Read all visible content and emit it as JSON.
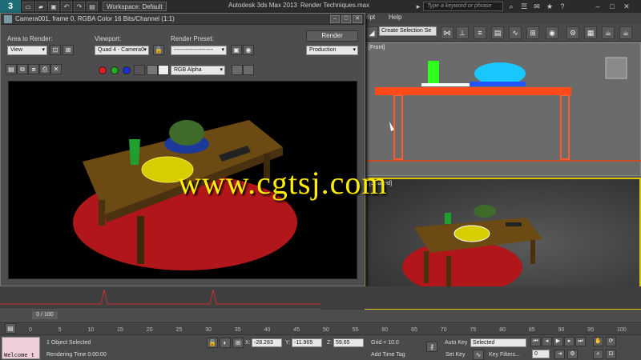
{
  "titlebar": {
    "logo": "3",
    "workspace": "Workspace: Default",
    "app_title": "Autodesk 3ds Max  2013",
    "file_title": "Render Techniques.max",
    "search_placeholder": "Type a keyword or phrase"
  },
  "menu": {
    "items": [
      "ript",
      "Help"
    ]
  },
  "toolbar": {
    "selection_set": "Create Selection Se"
  },
  "render_window": {
    "title": "Camera001, frame 0, RGBA Color 16 Bits/Channel (1:1)",
    "area_label": "Area to Render:",
    "area_value": "View",
    "viewport_label": "Viewport:",
    "viewport_value": "Quad 4 - Camera0",
    "preset_label": "Render Preset:",
    "preset_value": "---------------------",
    "render_button": "Render",
    "production_value": "Production",
    "channel_value": "RGB Alpha"
  },
  "viewports": {
    "top_label": "[Front]",
    "bottom_label": "[Shaded]"
  },
  "timeline": {
    "frame_label": "0 / 100",
    "ticks": [
      "0",
      "5",
      "10",
      "15",
      "20",
      "25",
      "30",
      "35",
      "40",
      "45",
      "50",
      "55",
      "60",
      "65",
      "70",
      "75",
      "80",
      "85",
      "90",
      "95",
      "100"
    ]
  },
  "status": {
    "maxscript_text": "Welcome t",
    "selected": "1 Object Selected",
    "rendering_time": "Rendering Time  0:00:00",
    "x_label": "X:",
    "x_value": "-28.283",
    "y_label": "Y:",
    "y_value": "-11.965",
    "z_label": "Z:",
    "z_value": "59.65",
    "grid": "Grid = 10.0",
    "add_time_tag": "Add Time Tag",
    "auto_key": "Auto Key",
    "selected_drop": "Selected",
    "set_key": "Set Key",
    "key_filters": "Key Filters...",
    "frame_field": "0"
  },
  "watermark": "www.cgtsj.com",
  "colors": {
    "table_top": "#6b4a14",
    "floor_ellipse": "#b0161a",
    "plate": "#d7cd00",
    "cup": "#1fa02e",
    "bowl": "#1b3a9a",
    "plant": "#3f6b2a",
    "active_viewport_border": "#d8c400"
  }
}
